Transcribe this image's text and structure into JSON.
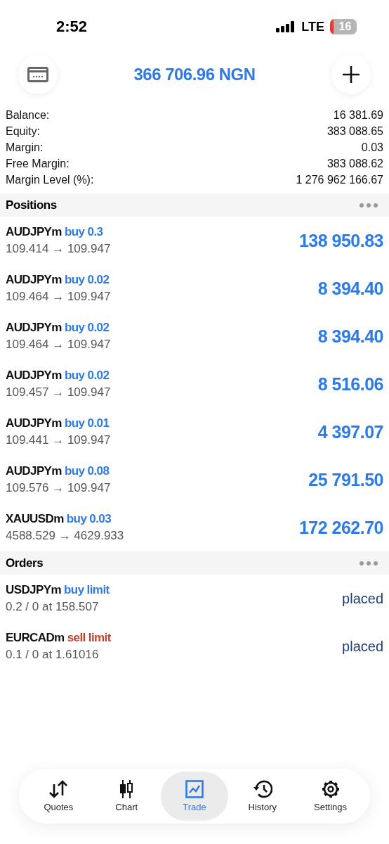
{
  "status_bar": {
    "time": "2:52",
    "network": "LTE",
    "battery": "16"
  },
  "header": {
    "balance_title": "366 706.96 NGN"
  },
  "summary": [
    {
      "label": "Balance:",
      "value": "16 381.69"
    },
    {
      "label": "Equity:",
      "value": "383 088.65"
    },
    {
      "label": "Margin:",
      "value": "0.03"
    },
    {
      "label": "Free Margin:",
      "value": "383 088.62"
    },
    {
      "label": "Margin Level (%):",
      "value": "1 276 962 166.67"
    }
  ],
  "positions": {
    "title": "Positions",
    "items": [
      {
        "symbol": "AUDJPYm",
        "kind": "buy",
        "action": "buy 0.3",
        "prices": "109.414 → 109.947",
        "profit": "138 950.83"
      },
      {
        "symbol": "AUDJPYm",
        "kind": "buy",
        "action": "buy 0.02",
        "prices": "109.464 → 109.947",
        "profit": "8 394.40"
      },
      {
        "symbol": "AUDJPYm",
        "kind": "buy",
        "action": "buy 0.02",
        "prices": "109.464 → 109.947",
        "profit": "8 394.40"
      },
      {
        "symbol": "AUDJPYm",
        "kind": "buy",
        "action": "buy 0.02",
        "prices": "109.457 → 109.947",
        "profit": "8 516.06"
      },
      {
        "symbol": "AUDJPYm",
        "kind": "buy",
        "action": "buy 0.01",
        "prices": "109.441 → 109.947",
        "profit": "4 397.07"
      },
      {
        "symbol": "AUDJPYm",
        "kind": "buy",
        "action": "buy 0.08",
        "prices": "109.576 → 109.947",
        "profit": "25 791.50"
      },
      {
        "symbol": "XAUUSDm",
        "kind": "buy",
        "action": "buy 0.03",
        "prices": "4588.529 → 4629.933",
        "profit": "172 262.70"
      }
    ]
  },
  "orders": {
    "title": "Orders",
    "items": [
      {
        "symbol": "USDJPYm",
        "kind": "buy",
        "action": "buy limit",
        "details": "0.2 / 0 at 158.507",
        "status": "placed"
      },
      {
        "symbol": "EURCADm",
        "kind": "sell",
        "action": "sell limit",
        "details": "0.1 / 0 at 1.61016",
        "status": "placed"
      }
    ]
  },
  "tabs": [
    {
      "label": "Quotes",
      "kind": "quotes",
      "selected": false
    },
    {
      "label": "Chart",
      "kind": "chart",
      "selected": false
    },
    {
      "label": "Trade",
      "kind": "trade",
      "selected": true
    },
    {
      "label": "History",
      "kind": "history",
      "selected": false
    },
    {
      "label": "Settings",
      "kind": "settings",
      "selected": false
    }
  ]
}
